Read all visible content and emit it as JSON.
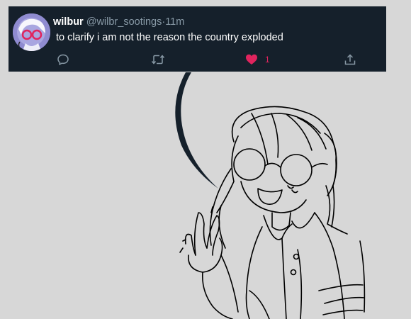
{
  "tweet": {
    "display_name": "wilbur",
    "handle": "@wilbr_sootings",
    "separator": "·",
    "time": "11m",
    "text": "to clarify i am not the reason the country exploded",
    "like_count": "1",
    "liked": true
  },
  "icons": {
    "reply": "speech-bubble-icon",
    "retweet": "retweet-arrows-icon",
    "like": "heart-icon",
    "share": "share-upload-icon"
  },
  "colors": {
    "tweet_background": "#15202b",
    "page_background": "#d7d7d7",
    "secondary_text": "#8899a6",
    "like_active": "#e0245e"
  }
}
